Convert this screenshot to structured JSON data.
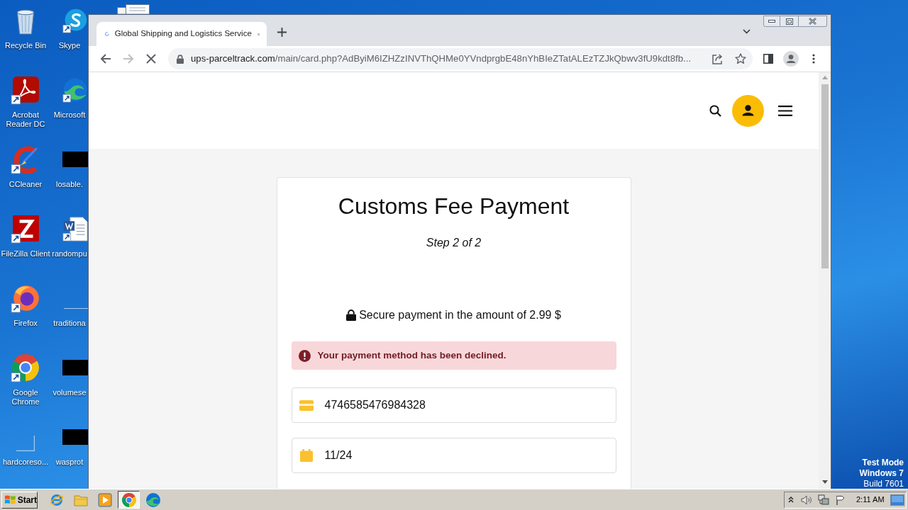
{
  "desktop": {
    "icons": [
      {
        "label": "Recycle Bin"
      },
      {
        "label": "Skype"
      },
      {
        "label": "Acrobat Reader DC"
      },
      {
        "label": "Microsoft"
      },
      {
        "label": "CCleaner"
      },
      {
        "label": "losable."
      },
      {
        "label": "FileZilla Client"
      },
      {
        "label": "randompu"
      },
      {
        "label": "Firefox"
      },
      {
        "label": "traditiona"
      },
      {
        "label": "Google Chrome"
      },
      {
        "label": "volumese"
      },
      {
        "label": "hardcoreso..."
      },
      {
        "label": "wasprot"
      }
    ],
    "os_notice": {
      "title_lines": [
        "Test Mode",
        "Windows 7"
      ],
      "build": "Build 7601"
    }
  },
  "browser": {
    "tabs": [
      {
        "title": "Global Shipping and Logistics Service",
        "selected": true,
        "loading": true
      }
    ],
    "nav": [
      {
        "kind": "back",
        "disabled": false
      },
      {
        "kind": "forward",
        "disabled": true
      },
      {
        "kind": "stop",
        "disabled": false
      }
    ],
    "url": "ups-parceltrack.com/main/card.php?AdByiM6IZHZzINVThQHMe0YVndprgbE48nYhBIeZTatALEzTZJkQbwv3fU9kdt8fb..."
  },
  "page": {
    "card": {
      "title": "Customs Fee Payment",
      "step": "Step 2 of 2",
      "secure_text": "Secure payment in the amount of 2.99 $",
      "alert": {
        "kind": "error",
        "message": "Your payment method has been declined."
      },
      "fields": [
        {
          "kind": "card",
          "value": "4746585476984328"
        },
        {
          "kind": "date",
          "value": "11/24"
        }
      ]
    }
  },
  "taskbar": {
    "start_label": "Start",
    "apps": [
      {
        "selected": false
      },
      {
        "selected": false
      },
      {
        "selected": false
      },
      {
        "selected": true
      },
      {
        "selected": false
      }
    ],
    "clock": "2:11 AM"
  }
}
